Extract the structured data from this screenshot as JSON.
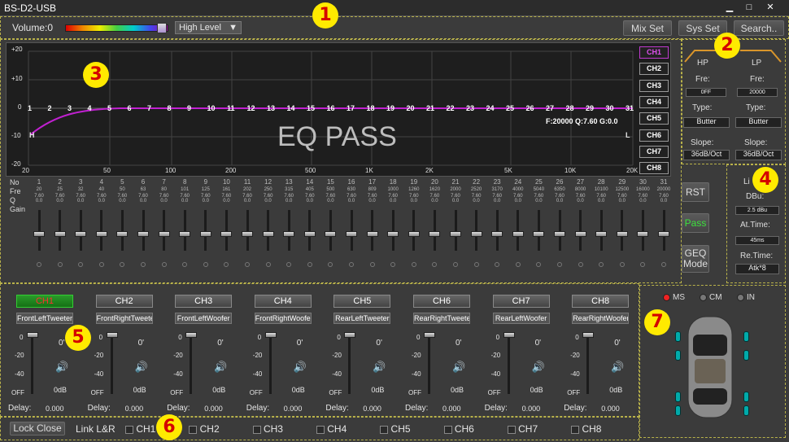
{
  "window": {
    "title": "BS-D2-USB",
    "min": "▁",
    "max": "□",
    "close": "✕"
  },
  "toolbar": {
    "volume": "Volume:0",
    "level": "High Level",
    "mix_set": "Mix Set",
    "sys_set": "Sys Set",
    "search": "Search.."
  },
  "badges": [
    "1",
    "2",
    "3",
    "4",
    "5",
    "6",
    "7"
  ],
  "eq": {
    "y_ticks": [
      "+20",
      "+10",
      "0",
      "-10",
      "-20"
    ],
    "x_ticks": [
      "20",
      "50",
      "100",
      "200",
      "500",
      "1K",
      "2K",
      "5K",
      "10K",
      "20K"
    ],
    "band_numbers": [
      "1",
      "2",
      "3",
      "4",
      "5",
      "6",
      "7",
      "8",
      "9",
      "10",
      "11",
      "12",
      "13",
      "14",
      "15",
      "16",
      "17",
      "18",
      "19",
      "20",
      "21",
      "22",
      "23",
      "24",
      "25",
      "26",
      "27",
      "28",
      "29",
      "30",
      "31"
    ],
    "h_marker": "H",
    "l_marker": "L",
    "overlay": "EQ PASS",
    "info": "F:20000 Q:7.60 G:0.0",
    "channels": [
      "CH1",
      "CH2",
      "CH3",
      "CH4",
      "CH5",
      "CH6",
      "CH7",
      "CH8"
    ],
    "row_labels": {
      "no": "No",
      "fre": "Fre",
      "q": "Q",
      "gain": "Gain"
    },
    "freqs": [
      "20",
      "25",
      "32",
      "40",
      "50",
      "63",
      "80",
      "101",
      "125",
      "161",
      "202",
      "250",
      "315",
      "405",
      "500",
      "630",
      "809",
      "1000",
      "1260",
      "1620",
      "2000",
      "2520",
      "3170",
      "4000",
      "5040",
      "6350",
      "8000",
      "10100",
      "12500",
      "16000",
      "20000"
    ],
    "q": "7.60",
    "gain": "0.0"
  },
  "crossover": {
    "hp": "HP",
    "lp": "LP",
    "fre": "Fre:",
    "type": "Type:",
    "slope": "Slope:",
    "hp_fre": "0FF",
    "lp_fre": "20000",
    "hp_type": "Butter",
    "lp_type": "Butter",
    "hp_slope": "36dB/Oct",
    "lp_slope": "36dB/Oct"
  },
  "side_buttons": {
    "rst": "RST",
    "pass": "Pass",
    "geq": "GEQ\nMode"
  },
  "limiter": {
    "label": "Li",
    "dbu": "DBu:",
    "dbu_val": "2.5 dBu",
    "at": "At.Time:",
    "at_val": "45ms",
    "re": "Re.Time:",
    "re_val": "Atk*8"
  },
  "channels": [
    {
      "title": "CH1",
      "name": "FrontLeftTweeter"
    },
    {
      "title": "CH2",
      "name": "FrontRightTweeter"
    },
    {
      "title": "CH3",
      "name": "FrontLeftWoofer"
    },
    {
      "title": "CH4",
      "name": "FrontRightWoofer"
    },
    {
      "title": "CH5",
      "name": "RearLeftTweeter"
    },
    {
      "title": "CH6",
      "name": "RearRightTweeter"
    },
    {
      "title": "CH7",
      "name": "RearLeftWoofer"
    },
    {
      "title": "CH8",
      "name": "RearRightWoofer"
    }
  ],
  "ch_common": {
    "s0": "0",
    "s20": "-20",
    "s40": "-40",
    "off": "OFF",
    "phase": "0'",
    "db": "0dB",
    "delay": "Delay:",
    "delay_val": "0.000"
  },
  "bottom": {
    "lock": "Lock Close",
    "link": "Link L&R",
    "checks": [
      "CH1",
      "CH2",
      "CH3",
      "CH4",
      "CH5",
      "CH6",
      "CH7",
      "CH8"
    ]
  },
  "mode": {
    "ms": "MS",
    "cm": "CM",
    "in": "IN"
  }
}
